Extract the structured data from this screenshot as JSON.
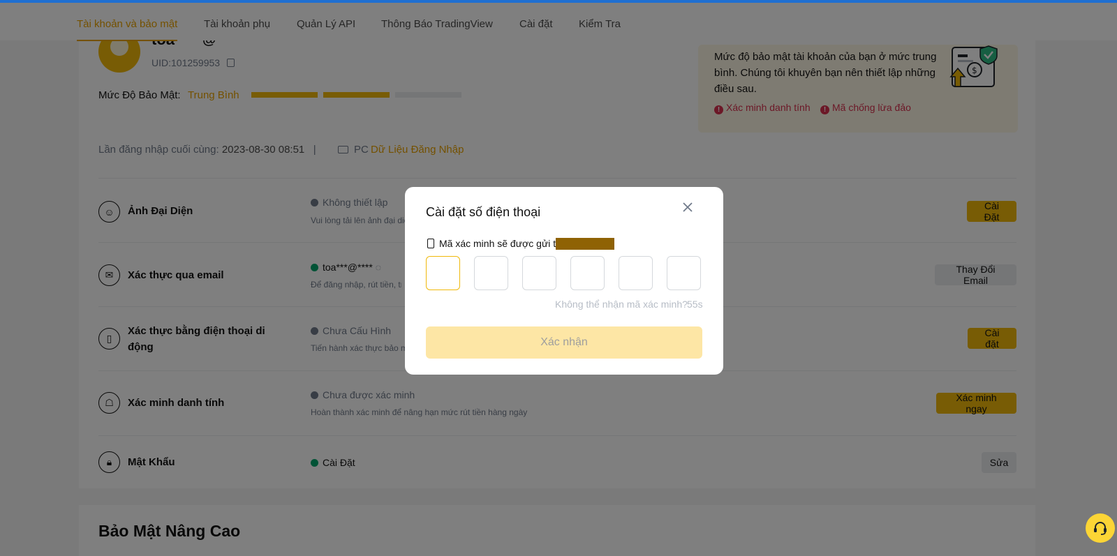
{
  "nav": {
    "tabs": [
      {
        "label": "Tài khoản và bảo mật",
        "active": true
      },
      {
        "label": "Tài khoản phụ"
      },
      {
        "label": "Quản Lý API"
      },
      {
        "label": "Thông Báo TradingView"
      },
      {
        "label": "Cài đặt"
      },
      {
        "label": "Kiểm Tra"
      }
    ]
  },
  "profile": {
    "username": "toa",
    "at": "@",
    "uid": "UID:101259953",
    "security_label": "Mức Độ Bảo Mật:",
    "security_level": "Trung Bình",
    "security_bars_filled": 2,
    "security_bars_total": 3,
    "last_login_label": "Lần đăng nhập cuối cùng:",
    "last_login_value": "2023-08-30 08:51",
    "separator": "|",
    "device": "PC",
    "login_data_link": "Dữ Liệu Đăng Nhập"
  },
  "advice": {
    "text": "Mức độ bảo mật tài khoản của bạn ở mức trung bình. Chúng tôi khuyên bạn nên thiết lập những điều sau.",
    "items": [
      "Xác minh danh tính",
      "Mã chống lừa đảo"
    ],
    "icon": "warning-icon"
  },
  "rows": [
    {
      "title": "Ảnh Đại Diện",
      "icon": "avatar-icon",
      "status": "Không thiết lập",
      "status_color": "#707a8a",
      "desc": "Vui lòng tải lên ảnh đại diện",
      "button": "Cài Đặt",
      "button_style": "primary"
    },
    {
      "title": "Xác thực qua email",
      "icon": "mail-icon",
      "status": "toa***@****",
      "status_color": "#03a66d",
      "desc": "Để đăng nhập, rút tiền, truy",
      "button": "Thay Đổi Email",
      "button_style": "secondary"
    },
    {
      "title": "Xác thực bằng điện thoại di động",
      "icon": "phone-icon",
      "status": "Chưa Cấu Hình",
      "status_color": "#707a8a",
      "desc": "Tiến hành xác thực bảo mật",
      "button": "Cài đặt",
      "button_style": "primary"
    },
    {
      "title": "Xác minh danh tính",
      "icon": "id-card-icon",
      "status": "Chưa được xác minh",
      "status_color": "#707a8a",
      "desc": "Hoàn thành xác minh để nâng hạn mức rút tiền hàng ngày",
      "button": "Xác minh ngay",
      "button_style": "primary"
    },
    {
      "title": "Mật Khẩu",
      "icon": "lock-icon",
      "status": "Cài Đặt",
      "status_color": "#03a66d",
      "desc": "",
      "button": "Sửa",
      "button_style": "secondary"
    }
  ],
  "advanced": {
    "title": "Bảo Mật Nâng Cao"
  },
  "modal": {
    "title": "Cài đặt số điện thoại",
    "sent_to": "Mã xác minh sẽ được gửi tới",
    "otp_count": 6,
    "resend_text": "Không thể nhận mã xác minh?",
    "countdown": "55s",
    "confirm_label": "Xác nhận"
  },
  "colors": {
    "accent": "#f0b90b",
    "accent_text": "#e9a200",
    "danger": "#d9304e",
    "success": "#03a66d",
    "topbar": "#1f6fd1"
  }
}
